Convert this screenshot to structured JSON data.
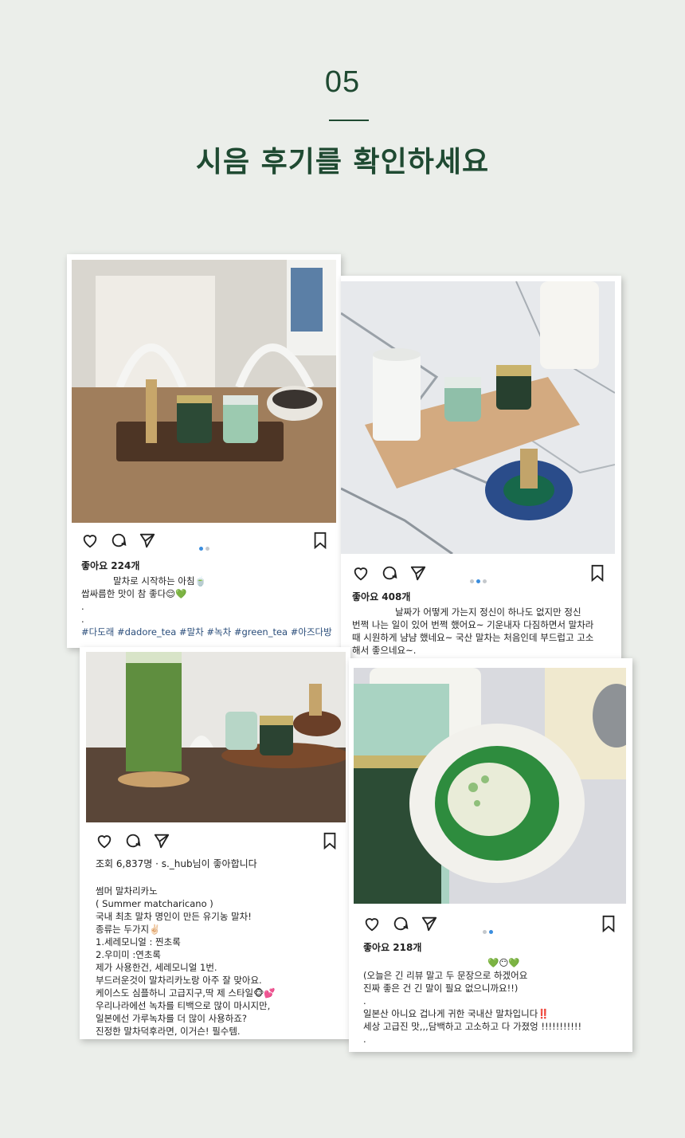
{
  "header": {
    "number": "05",
    "title": "시음 후기를 확인하세요"
  },
  "colors": {
    "accent": "#1f4a32",
    "background": "#ebeeea",
    "link": "#2a4d7a",
    "dot_active": "#3a8dde"
  },
  "posts": [
    {
      "likes": "좋아요 224개",
      "lines": [
        "말차로 시작하는 아침🍵",
        "쌉싸름한 맛이 참 좋다😌💚",
        ".",
        "."
      ],
      "hashtags": "#다도래 #dadore_tea #말차 #녹차 #green_tea #아즈다방",
      "icons": [
        "heart-icon",
        "comment-icon",
        "share-icon",
        "bookmark-icon"
      ]
    },
    {
      "likes": "좋아요 408개",
      "lines": [
        "날짜가 어떻게 가는지 정신이 하나도 없지만 정신",
        "번쩍 나는 일이 있어 번쩍 했어요~ 기운내자 다짐하면서 말차라",
        "때 시원하게 냠냠 했네요~ 국산 말차는 처음인데 부드럽고 고소",
        "해서 좋으네요~.",
        "."
      ],
      "icons": [
        "heart-icon",
        "comment-icon",
        "share-icon",
        "bookmark-icon"
      ]
    },
    {
      "likes": "조회 6,837명 · s._hub님이 좋아합니다",
      "lines": [
        "썸머 말차리카노",
        "( Summer matcharicano )",
        "국내 최초 말차 명인이 만든 유기농 말차!",
        "종류는 두가지✌🏻",
        "1.세레모니얼 : 찐초록",
        "2.우미미 :연초록",
        "제가 사용한건, 세레모니얼 1번.",
        "부드러운것이 말차리카노랑 아주 잘 맞아요.",
        "케이스도 심플하니 고급지구,딱 제 스타일🐵💕",
        "우리나라에선 녹차를 티백으로 많이 마시지만,",
        "일본에선 가루녹차를 더 많이 사용하죠?",
        "진정한 말차덕후라면, 이거슨! 필수템."
      ],
      "icons": [
        "heart-icon",
        "comment-icon",
        "share-icon",
        "bookmark-icon"
      ]
    },
    {
      "likes": "좋아요 218개",
      "lines": [
        "💚😶💚",
        "(오늘은 긴 리뷰 말고 두 문장으로 하겠어요",
        "진짜 좋은 건 긴 말이 필요 없으니까요!!)",
        ".",
        "일본산 아니요 겁나게 귀한 국내산 말차입니다‼️",
        "세상 고급진 맛,,,담백하고 고소하고 다 가졌엉 !!!!!!!!!!!",
        "."
      ],
      "icons": [
        "heart-icon",
        "comment-icon",
        "share-icon",
        "bookmark-icon"
      ]
    }
  ]
}
